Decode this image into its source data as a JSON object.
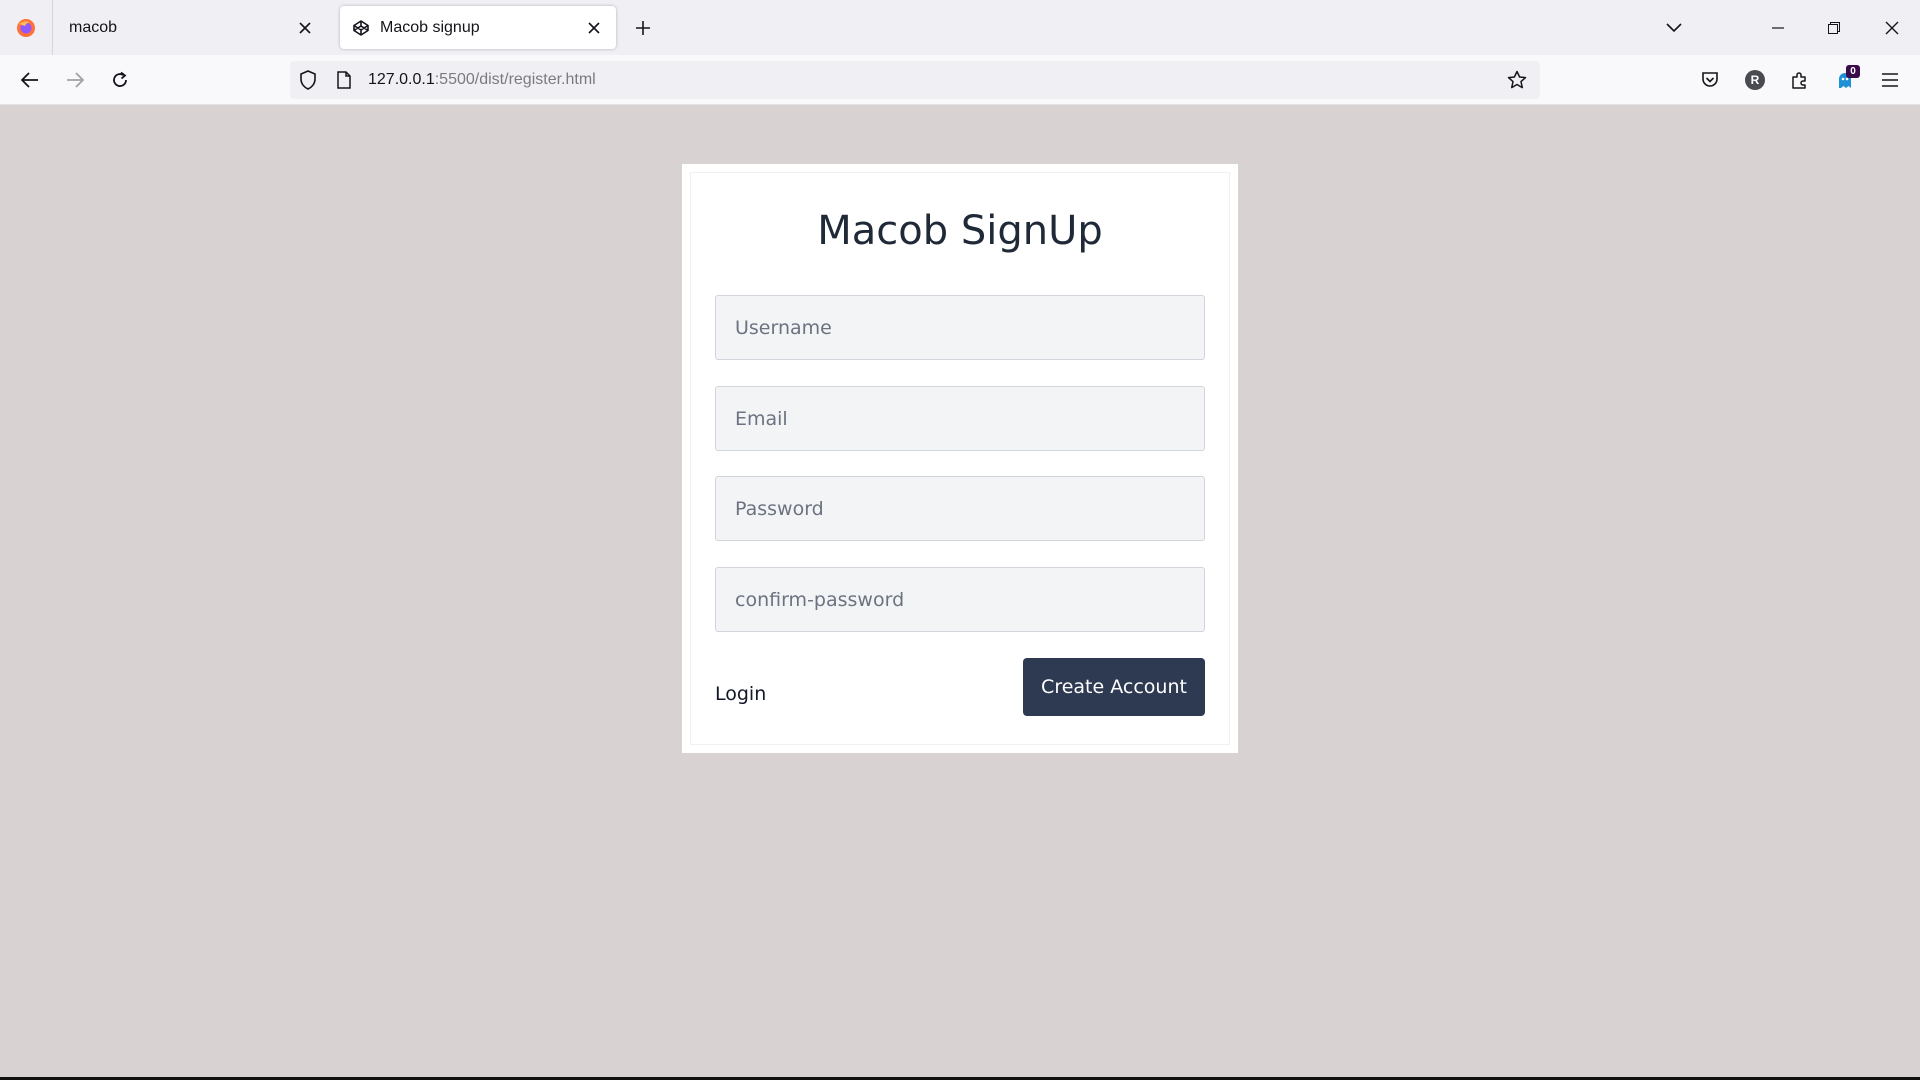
{
  "browser": {
    "tabs": [
      {
        "title": "macob",
        "active": false
      },
      {
        "title": "Macob signup",
        "active": true
      }
    ],
    "url": {
      "host": "127.0.0.1",
      "path": ":5500/dist/register.html"
    },
    "extension_badge": "0",
    "profile_initial": "R"
  },
  "form": {
    "title": "Macob SignUp",
    "username_placeholder": "Username",
    "email_placeholder": "Email",
    "password_placeholder": "Password",
    "confirm_password_placeholder": "confirm-password",
    "login_label": "Login",
    "submit_label": "Create Account"
  },
  "colors": {
    "page_background": "#d8d2d2",
    "button_background": "#2d3a52",
    "field_background": "#f3f4f6"
  }
}
